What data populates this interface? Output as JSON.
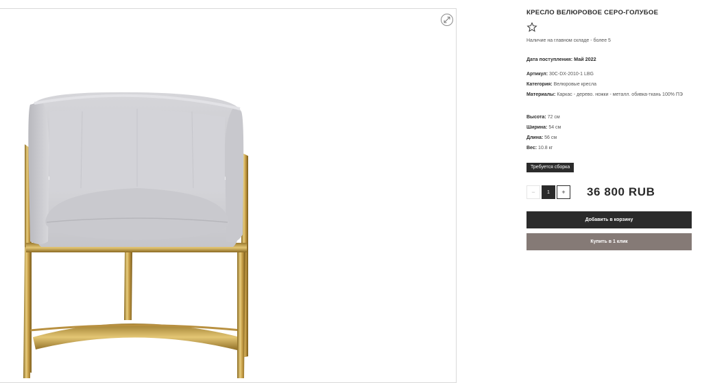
{
  "product": {
    "title": "КРЕСЛО ВЕЛЮРОВОЕ СЕРО-ГОЛУБОЕ",
    "favorite_icon": "star-outline-icon",
    "stock": "Наличие на главном складе - более 5",
    "arrival_label": "Дата поступления:",
    "arrival_value": "Май 2022",
    "sku_label": "Артикул:",
    "sku_value": "30C-DX-2010-1 LBG",
    "category_label": "Категория:",
    "category_value": "Велюровые кресла",
    "materials_label": "Материалы:",
    "materials_value": "Каркас - дерево. ножки - металл. обивка-ткань 100% ПЭ",
    "height_label": "Высота:",
    "height_value": "72 см",
    "width_label": "Ширина:",
    "width_value": "54 см",
    "length_label": "Длина:",
    "length_value": "56 см",
    "weight_label": "Вес:",
    "weight_value": "10.8 кг",
    "assembly_badge": "Требуется сборка"
  },
  "quantity": {
    "minus": "−",
    "value": "1",
    "plus": "+"
  },
  "price": "36 800 RUB",
  "buttons": {
    "add_to_cart": "Добавить в корзину",
    "buy_one_click": "Купить в 1 клик"
  },
  "gallery": {
    "zoom_icon": "expand-arrows-icon"
  },
  "colors": {
    "dark": "#2b2b2b",
    "oneclick_button": "#857a76",
    "upholstery": "#cfcfd3",
    "frame_gold": "#c7a24a"
  }
}
